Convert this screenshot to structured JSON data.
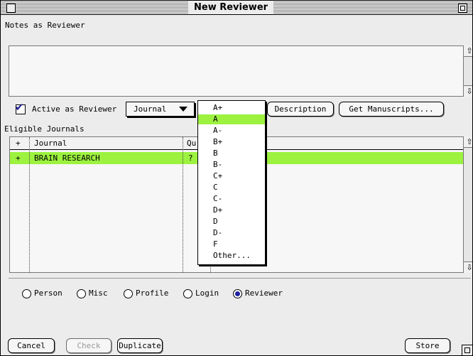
{
  "window": {
    "title": "New Reviewer"
  },
  "notes": {
    "label": "Notes as Reviewer",
    "value": ""
  },
  "active": {
    "label": "Active as Reviewer",
    "checked": true
  },
  "journal_popup": {
    "selected": "Journal"
  },
  "buttons": {
    "description": "Description",
    "get_manuscripts": "Get Manuscripts...",
    "cancel": "Cancel",
    "check": "Check",
    "duplicate": "Duplicate",
    "store": "Store"
  },
  "journals": {
    "label": "Eligible Journals",
    "columns": [
      "+",
      "Journal",
      "Qu"
    ],
    "rows": [
      {
        "plus": "+",
        "journal": "BRAIN RESEARCH",
        "quality": "?"
      }
    ]
  },
  "grade_menu": {
    "items": [
      "A+",
      "A",
      "A-",
      "B+",
      "B",
      "B-",
      "C+",
      "C",
      "C-",
      "D+",
      "D",
      "D-",
      "F",
      "Other..."
    ],
    "highlighted": "A"
  },
  "radios": {
    "options": [
      "Person",
      "Misc",
      "Profile",
      "Login",
      "Reviewer"
    ],
    "selected": "Reviewer"
  },
  "colors": {
    "highlight": "#9cf23f",
    "radio_fill": "#1e1e9e",
    "checkmark": "#202098"
  }
}
